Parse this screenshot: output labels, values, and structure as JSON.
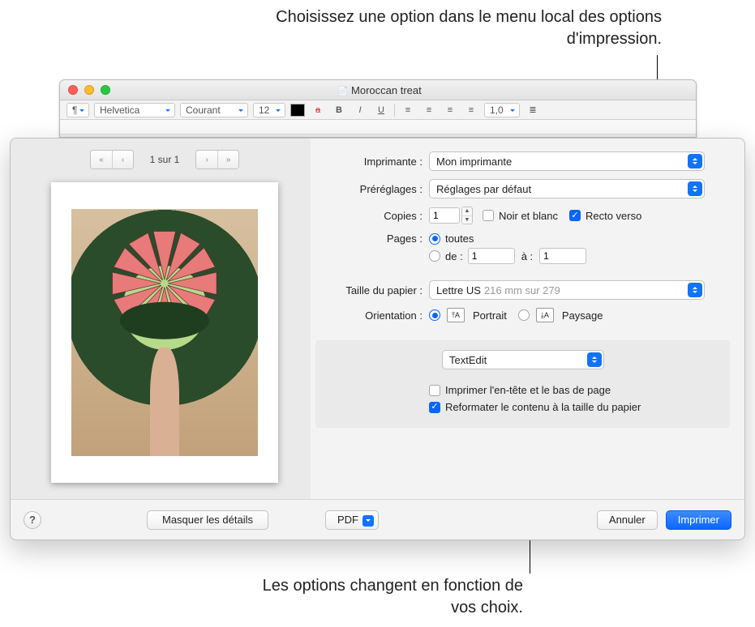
{
  "annotations": {
    "top": "Choisissez une option dans le menu local des options d'impression.",
    "bottom": "Les options changent en fonction de vos choix."
  },
  "editor": {
    "title": "Moroccan treat",
    "toolbar": {
      "paragraph_style": "¶",
      "font": "Helvetica",
      "typeface": "Courant",
      "size": "12",
      "bold": "B",
      "italic": "I",
      "underline": "U",
      "line_spacing": "1,0"
    }
  },
  "print": {
    "pager": {
      "label": "1 sur 1"
    },
    "labels": {
      "printer": "Imprimante :",
      "presets": "Préréglages :",
      "copies": "Copies :",
      "pages": "Pages :",
      "paper_size": "Taille du papier :",
      "orientation": "Orientation :"
    },
    "printer": "Mon imprimante",
    "preset": "Réglages par défaut",
    "copies": "1",
    "bw_label": "Noir et blanc",
    "bw_checked": false,
    "twosided_label": "Recto verso",
    "twosided_checked": true,
    "pages_all_label": "toutes",
    "pages_from_label": "de :",
    "pages_to_label": "à :",
    "pages_from": "1",
    "pages_to": "1",
    "pages_mode_all": true,
    "paper_size": "Lettre US",
    "paper_dims": "216 mm sur 279",
    "orientation_portrait_label": "Portrait",
    "orientation_landscape_label": "Paysage",
    "orientation_portrait": true,
    "app_menu": "TextEdit",
    "app_opts": {
      "header_footer_label": "Imprimer l'en-tête et le bas de page",
      "header_footer_checked": false,
      "rewrap_label": "Reformater le contenu à la taille du papier",
      "rewrap_checked": true
    },
    "footer": {
      "help": "?",
      "hide_details": "Masquer les détails",
      "pdf": "PDF",
      "cancel": "Annuler",
      "print": "Imprimer"
    }
  }
}
